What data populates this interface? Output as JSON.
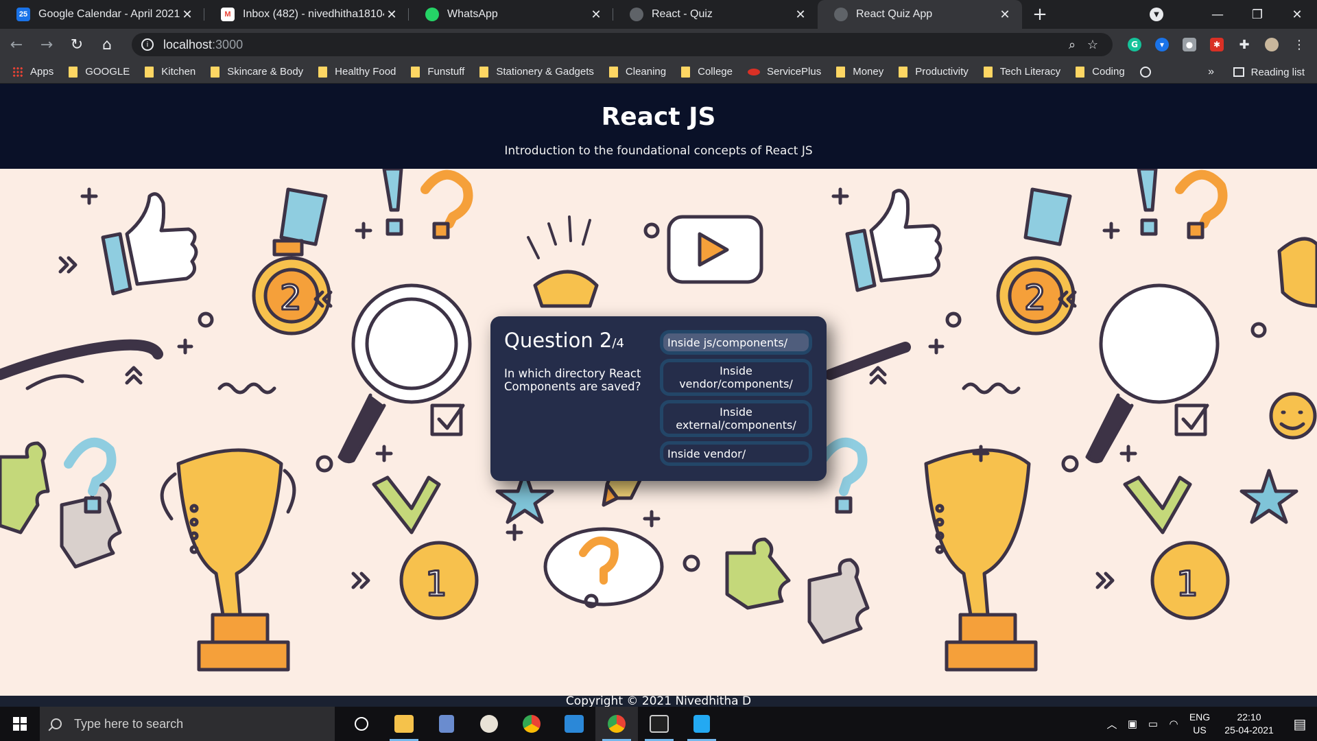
{
  "browser": {
    "tabs": [
      {
        "title": "Google Calendar - April 2021",
        "icon": "calendar-icon",
        "icon_text": "25",
        "color": "#1a73e8"
      },
      {
        "title": "Inbox (482) - nivedhitha18104@",
        "icon": "gmail-icon",
        "icon_text": "M",
        "color": "#ea4335"
      },
      {
        "title": "WhatsApp",
        "icon": "whatsapp-icon",
        "icon_text": "",
        "color": "#25d366"
      },
      {
        "title": "React - Quiz",
        "icon": "globe-icon",
        "icon_text": "",
        "color": "#5f6368"
      },
      {
        "title": "React Quiz App",
        "icon": "globe-icon",
        "icon_text": "",
        "color": "#5f6368"
      }
    ],
    "active_tab_index": 4,
    "url_host": "localhost",
    "url_port": ":3000",
    "bookmarks": [
      "Apps",
      "GOOGLE",
      "Kitchen",
      "Skincare & Body",
      "Healthy Food",
      "Funstuff",
      "Stationery & Gadgets",
      "Cleaning",
      "College",
      "ServicePlus",
      "Money",
      "Productivity",
      "Tech Literacy",
      "Coding"
    ],
    "bookmarks_more": "»",
    "reading_list": "Reading list"
  },
  "page": {
    "title": "React JS",
    "subtitle": "Introduction to the foundational concepts of React JS",
    "footer": "Copyright © 2021 Nivedhitha D",
    "background_color": "#fcede4",
    "header_color": "#0a1128"
  },
  "quiz": {
    "question_word": "Question 2",
    "question_total": "/4",
    "question_text": "In which directory React Components are saved?",
    "answers": [
      {
        "text": "Inside js/components/",
        "selected": true
      },
      {
        "text": "Inside vendor/components/",
        "selected": false
      },
      {
        "text": "Inside external/components/",
        "selected": false
      },
      {
        "text": "Inside vendor/",
        "selected": false
      }
    ],
    "card_color": "#252d4a",
    "answer_border_color": "#234668"
  },
  "taskbar": {
    "search_placeholder": "Type here to search",
    "lang_top": "ENG",
    "lang_bottom": "US",
    "time": "22:10",
    "date": "25-04-2021",
    "apps": [
      "cortana-icon",
      "file-explorer-icon",
      "calculator-icon",
      "compass-icon",
      "chrome-icon",
      "feedback-hub-icon",
      "chrome-active-icon",
      "terminal-icon",
      "vscode-icon"
    ]
  }
}
